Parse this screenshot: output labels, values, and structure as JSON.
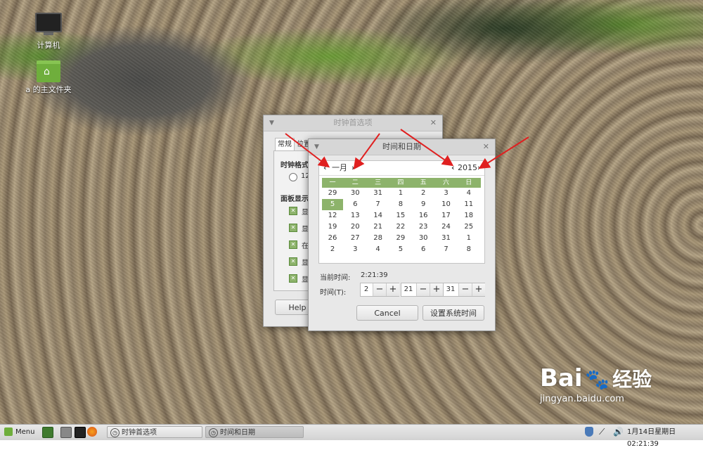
{
  "desktop": {
    "icons": [
      {
        "label": "计算机",
        "icon": "computer-icon"
      },
      {
        "label": "a 的主文件夹",
        "icon": "home-folder-icon"
      }
    ]
  },
  "clock_prefs": {
    "title": "时钟首选项",
    "tabs": [
      "常规",
      "位置"
    ],
    "section_clock_format": "时钟格式",
    "radio_12": "12",
    "section_panel": "面板显示",
    "checkbox_prefix": [
      "显",
      "显",
      "在",
      "显",
      "显"
    ],
    "help_label": "Help"
  },
  "time_date": {
    "title": "时间和日期",
    "month": "一月",
    "year": "2015",
    "weekdays": [
      "一",
      "二",
      "三",
      "四",
      "五",
      "六",
      "日"
    ],
    "weeks": [
      [
        "29",
        "30",
        "31",
        "1",
        "2",
        "3",
        "4"
      ],
      [
        "5",
        "6",
        "7",
        "8",
        "9",
        "10",
        "11"
      ],
      [
        "12",
        "13",
        "14",
        "15",
        "16",
        "17",
        "18"
      ],
      [
        "19",
        "20",
        "21",
        "22",
        "23",
        "24",
        "25"
      ],
      [
        "26",
        "27",
        "28",
        "29",
        "30",
        "31",
        "1"
      ],
      [
        "2",
        "3",
        "4",
        "5",
        "6",
        "7",
        "8"
      ]
    ],
    "selected_day": "5",
    "current_time_label": "当前时间:",
    "current_time": "2:21:39",
    "time_label": "时间(T):",
    "hour": "2",
    "minute": "21",
    "second": "31",
    "minus": "−",
    "plus": "+",
    "cancel_label": "Cancel",
    "set_label": "设置系统时间"
  },
  "taskbar": {
    "menu_label": "Menu",
    "tasks": [
      "时钟首选项",
      "时间和日期"
    ],
    "clock": "1月14日星期日 02:21:39"
  },
  "watermark": {
    "brand": "Bai",
    "brand2": "经验",
    "url": "jingyan.baidu.com"
  },
  "colors": {
    "accent_green": "#8db36b",
    "arrow_red": "#e02020"
  }
}
